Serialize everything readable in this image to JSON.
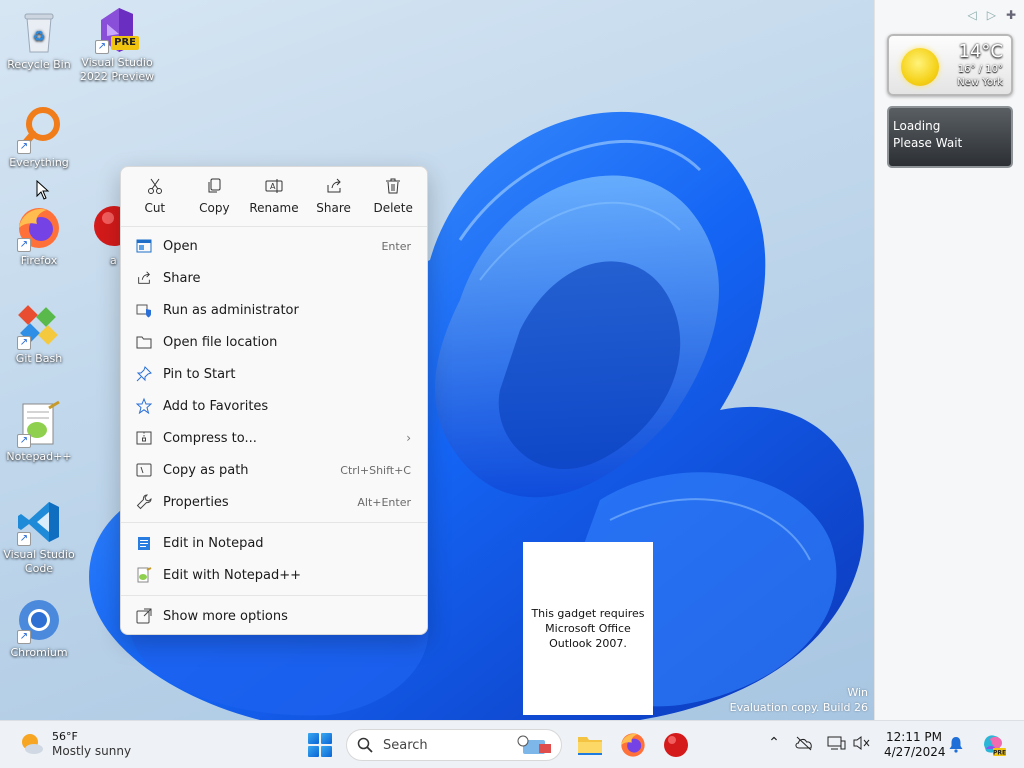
{
  "desktop_icons": [
    {
      "label": "Recycle Bin",
      "icon": "recycle-bin-icon"
    },
    {
      "label": "Visual Studio 2022 Preview",
      "icon": "visual-studio-preview-icon",
      "badge": "PRE"
    },
    {
      "label": "Everything",
      "icon": "everything-search-icon"
    },
    {
      "label": "Firefox",
      "icon": "firefox-icon"
    },
    {
      "label": "a",
      "icon": "app-red-icon"
    },
    {
      "label": "Git Bash",
      "icon": "git-bash-icon"
    },
    {
      "label": "Notepad++",
      "icon": "notepad-plus-plus-icon"
    },
    {
      "label": "Visual Studio Code",
      "icon": "vscode-icon"
    },
    {
      "label": "Chromium",
      "icon": "chromium-icon"
    }
  ],
  "context_menu": {
    "quick_actions": [
      {
        "label": "Cut",
        "icon": "scissors-icon"
      },
      {
        "label": "Copy",
        "icon": "copy-icon"
      },
      {
        "label": "Rename",
        "icon": "rename-icon"
      },
      {
        "label": "Share",
        "icon": "share-icon"
      },
      {
        "label": "Delete",
        "icon": "trash-icon"
      }
    ],
    "items": [
      {
        "label": "Open",
        "shortcut": "Enter",
        "icon": "open-window-icon"
      },
      {
        "label": "Share",
        "shortcut": "",
        "icon": "share-icon"
      },
      {
        "label": "Run as administrator",
        "shortcut": "",
        "icon": "shield-icon"
      },
      {
        "label": "Open file location",
        "shortcut": "",
        "icon": "folder-icon"
      },
      {
        "label": "Pin to Start",
        "shortcut": "",
        "icon": "pin-icon"
      },
      {
        "label": "Add to Favorites",
        "shortcut": "",
        "icon": "star-icon"
      },
      {
        "label": "Compress to...",
        "shortcut": "",
        "icon": "zip-icon",
        "submenu": true
      },
      {
        "label": "Copy as path",
        "shortcut": "Ctrl+Shift+C",
        "icon": "copy-path-icon"
      },
      {
        "label": "Properties",
        "shortcut": "Alt+Enter",
        "icon": "wrench-icon"
      }
    ],
    "extra_items": [
      {
        "label": "Edit in Notepad",
        "icon": "notepad-icon"
      },
      {
        "label": "Edit with Notepad++",
        "icon": "notepad-plus-plus-icon"
      }
    ],
    "more_options": {
      "label": "Show more options",
      "icon": "expand-icon"
    }
  },
  "sidebar": {
    "weather": {
      "temp": "14°C",
      "range": "16° / 10°",
      "city": "New York"
    },
    "loading": {
      "line1": "Loading",
      "line2": "Please Wait"
    }
  },
  "outlook_gadget": {
    "text": "This gadget requires Microsoft Office Outlook 2007."
  },
  "watermark": {
    "line1": "Win",
    "line2": "Evaluation copy. Build 26"
  },
  "taskbar": {
    "weather_temp": "56°F",
    "weather_cond": "Mostly sunny",
    "search_placeholder": "Search",
    "time": "12:11 PM",
    "date": "4/27/2024"
  },
  "colors": {
    "accent": "#0a64d6",
    "menu_bg": "#f9f9f9",
    "taskbar_bg": "#eef1f5"
  }
}
